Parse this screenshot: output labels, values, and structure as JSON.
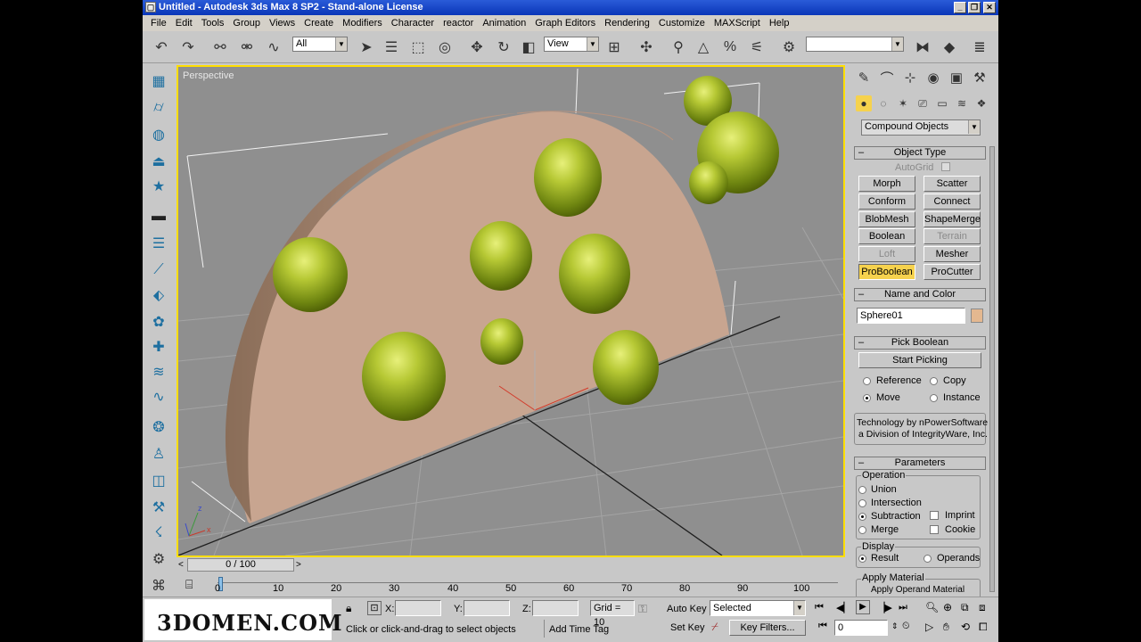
{
  "window": {
    "title": "Untitled - Autodesk 3ds Max 8 SP2 - Stand-alone License"
  },
  "menu": [
    "File",
    "Edit",
    "Tools",
    "Group",
    "Views",
    "Create",
    "Modifiers",
    "Character",
    "reactor",
    "Animation",
    "Graph Editors",
    "Rendering",
    "Customize",
    "MAXScript",
    "Help"
  ],
  "toolbar": {
    "selection_filter": "All",
    "reference_coord": "View",
    "named_selection": ""
  },
  "viewport": {
    "label": "Perspective",
    "axis_x": "x",
    "axis_z": "z"
  },
  "command_panel": {
    "category": "Compound Objects",
    "object_type": {
      "title": "Object Type",
      "autogrid_label": "AutoGrid",
      "buttons": [
        "Morph",
        "Scatter",
        "Conform",
        "Connect",
        "BlobMesh",
        "ShapeMerge",
        "Boolean",
        "Terrain",
        "Loft",
        "Mesher",
        "ProBoolean",
        "ProCutter"
      ]
    },
    "name_and_color": {
      "title": "Name and Color",
      "name": "Sphere01",
      "color": "#e4b890"
    },
    "pick_boolean": {
      "title": "Pick Boolean",
      "start_picking": "Start Picking",
      "reference": "Reference",
      "copy": "Copy",
      "move": "Move",
      "instance": "Instance",
      "credit_line1": "Technology by nPowerSoftware",
      "credit_line2": "a Division of IntegrityWare, Inc."
    },
    "parameters": {
      "title": "Parameters",
      "operation_label": "Operation",
      "union": "Union",
      "intersection": "Intersection",
      "subtraction": "Subtraction",
      "merge": "Merge",
      "imprint": "Imprint",
      "cookie": "Cookie",
      "display_label": "Display",
      "result": "Result",
      "operands": "Operands",
      "apply_material_label": "Apply Material",
      "apply_operand_material": "Apply Operand Material"
    }
  },
  "timeslider": {
    "frame": "0 / 100",
    "ticks": [
      "0",
      "10",
      "20",
      "30",
      "40",
      "50",
      "60",
      "70",
      "80",
      "90",
      "100"
    ]
  },
  "status": {
    "logo": "3DOMEN.COM",
    "x_label": "X:",
    "y_label": "Y:",
    "z_label": "Z:",
    "x_value": "",
    "y_value": "",
    "z_value": "",
    "grid": "Grid = 10",
    "auto_key": "Auto Key",
    "selected": "Selected",
    "set_key": "Set Key",
    "key_filters": "Key Filters...",
    "prompt": "Click or click-and-drag to select objects",
    "add_time_tag": "Add Time Tag",
    "current_frame": "0"
  }
}
